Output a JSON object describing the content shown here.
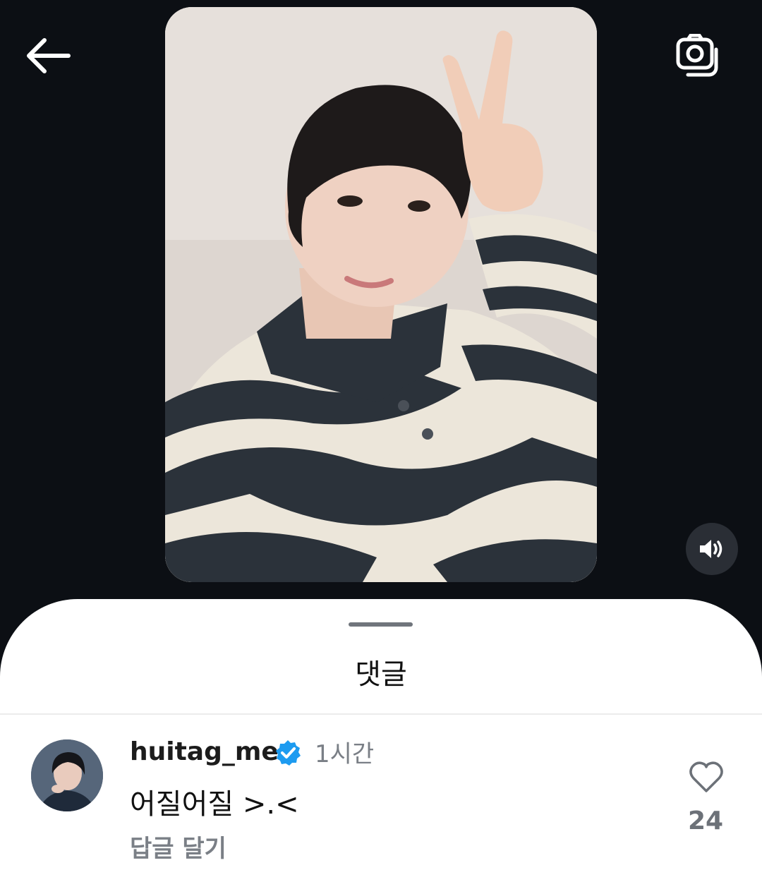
{
  "header": {
    "back_icon": "arrow-left-icon",
    "camera_icon": "camera-stack-icon"
  },
  "media": {
    "volume_icon": "speaker-volume-icon"
  },
  "sheet": {
    "title": "댓글"
  },
  "comment": {
    "username": "huitag_me",
    "verified_icon": "verified-badge-icon",
    "time": "1시간",
    "text": "어질어질 >.<",
    "reply_label": "답글 달기",
    "like_icon": "heart-outline-icon",
    "like_count": "24"
  },
  "colors": {
    "background": "#0c0f14",
    "sheet": "#ffffff",
    "verified": "#1d9bf0",
    "muted_text": "#7a7f86"
  }
}
